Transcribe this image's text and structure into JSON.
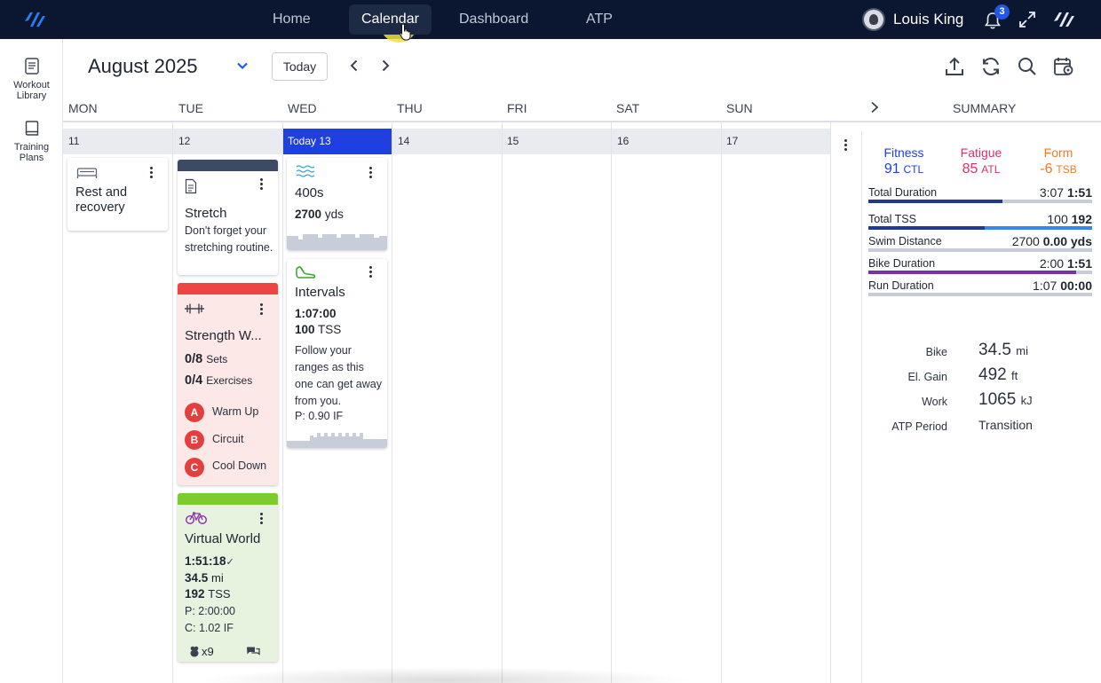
{
  "nav": {
    "links": [
      "Home",
      "Calendar",
      "Dashboard",
      "ATP"
    ],
    "active": "Calendar",
    "user_name": "Louis King",
    "notifications": "3"
  },
  "rail": {
    "workout_library": "Workout\nLibrary",
    "training_plans": "Training\nPlans"
  },
  "toolbar": {
    "month": "August 2025",
    "today_label": "Today"
  },
  "calendar": {
    "weekdays": [
      "MON",
      "TUE",
      "WED",
      "THU",
      "FRI",
      "SAT",
      "SUN"
    ],
    "dates": [
      "11",
      "12",
      "Today 13",
      "14",
      "15",
      "16",
      "17"
    ],
    "summary_label": "SUMMARY"
  },
  "workouts": {
    "rest": {
      "title": "Rest and recovery"
    },
    "stretch": {
      "title": "Stretch",
      "note": "Don't forget your stretching routine."
    },
    "strength": {
      "title": "Strength W...",
      "sets_value": "0/8",
      "sets_label": "Sets",
      "ex_value": "0/4",
      "ex_label": "Exercises",
      "blocks": [
        {
          "letter": "A",
          "name": "Warm Up"
        },
        {
          "letter": "B",
          "name": "Circuit"
        },
        {
          "letter": "C",
          "name": "Cool Down"
        }
      ]
    },
    "virtual": {
      "title": "Virtual World",
      "duration": "1:51:18",
      "check": "✓",
      "distance": "34.5",
      "distance_unit": "mi",
      "tss": "192",
      "tss_label": "TSS",
      "planned": "P: 2:00:00",
      "completed": "C: 1.02 IF",
      "kudos": "x9"
    },
    "swim": {
      "title": "400s",
      "distance": "2700",
      "unit": "yds"
    },
    "intervals": {
      "title": "Intervals",
      "duration": "1:07:00",
      "tss": "100",
      "tss_label": "TSS",
      "note": "Follow your ranges as this one can get away from you.",
      "if": "P: 0.90 IF"
    }
  },
  "summary": {
    "fitness": {
      "label": "Fitness",
      "value": "91",
      "unit": "CTL",
      "color": "#1f3fe0"
    },
    "fatigue": {
      "label": "Fatigue",
      "value": "85",
      "unit": "ATL",
      "color": "#d9326b"
    },
    "form": {
      "label": "Form",
      "value": "-6",
      "unit": "TSB",
      "color": "#f07a2a"
    },
    "rows": [
      {
        "label": "Total Duration",
        "planned": "3:07",
        "actual": "1:51",
        "fill": 0.6,
        "color": "#1f3a8f"
      },
      {
        "label": "Total TSS",
        "planned": "100",
        "actual": "192",
        "fill": 0.52,
        "color": "#1f3a8f",
        "fill2": 1.0,
        "color2": "#3b82f6"
      },
      {
        "label": "Swim Distance",
        "planned": "2700",
        "actual": "0.00 yds",
        "fill": 0,
        "color": "#1f3a8f"
      },
      {
        "label": "Bike Duration",
        "planned": "2:00",
        "actual": "1:51",
        "fill": 0.93,
        "color": "#7b2fa8"
      },
      {
        "label": "Run Duration",
        "planned": "1:07",
        "actual": "00:00",
        "fill": 0,
        "color": "#1f3a8f"
      }
    ],
    "stats": [
      {
        "label": "Bike",
        "value": "34.5",
        "unit": "mi"
      },
      {
        "label": "El. Gain",
        "value": "492",
        "unit": "ft"
      },
      {
        "label": "Work",
        "value": "1065",
        "unit": "kJ"
      },
      {
        "label": "ATP Period",
        "value": "Transition",
        "unit": ""
      }
    ]
  },
  "colors": {
    "nav_bg": "#0b1730",
    "today": "#1f3fe0",
    "strength": "#ef4444",
    "stretch": "#3d4a63",
    "bike": "#7ccc2c",
    "strength_bg": "#fde8e8",
    "bike_bg": "#e7f2df"
  }
}
